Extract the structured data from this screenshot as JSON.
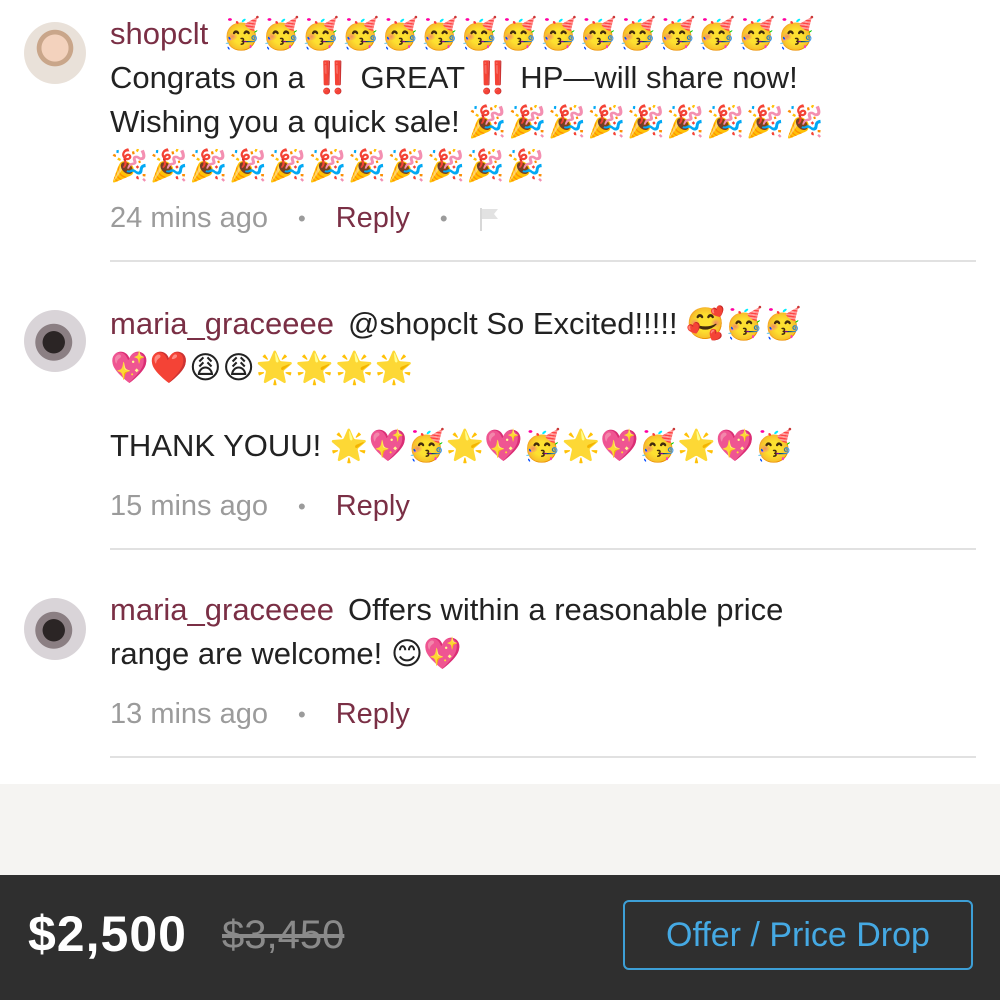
{
  "comments": [
    {
      "username": "shopclt",
      "emoji_inline": "🥳🥳🥳🥳🥳🥳🥳🥳🥳🥳🥳🥳🥳🥳🥳",
      "text_line1": "Congrats on a ‼️ GREAT ‼️ HP—will share now!",
      "text_line2": "Wishing you a quick sale!",
      "emoji_line2": "🎉🎉🎉🎉🎉🎉🎉🎉🎉",
      "emoji_line3": "🎉🎉🎉🎉🎉🎉🎉🎉🎉🎉🎉",
      "time": "24 mins ago",
      "reply": "Reply"
    },
    {
      "username": "maria_graceeee",
      "text_line1": "@shopclt So Excited!!!!! 🥰🥳🥳",
      "emoji_line2": "💖❤️😩😩🌟🌟🌟🌟",
      "text_line3": "THANK YOUU! 🌟💖🥳🌟💖🥳🌟💖🥳🌟💖🥳",
      "time": "15 mins ago",
      "reply": "Reply"
    },
    {
      "username": "maria_graceeee",
      "text_line1": "Offers within a reasonable price",
      "text_line2": "range are welcome! 😊💖",
      "time": "13 mins ago",
      "reply": "Reply"
    }
  ],
  "icons": {
    "flag": "flag-icon",
    "dot": "•"
  },
  "bottom_bar": {
    "price": "$2,500",
    "original_price": "$3,450",
    "offer_button": "Offer / Price Drop"
  },
  "colors": {
    "username": "#7a2f45",
    "meta": "#9b9b9b",
    "bar": "#2f2f2f",
    "button": "#45a9e3"
  }
}
